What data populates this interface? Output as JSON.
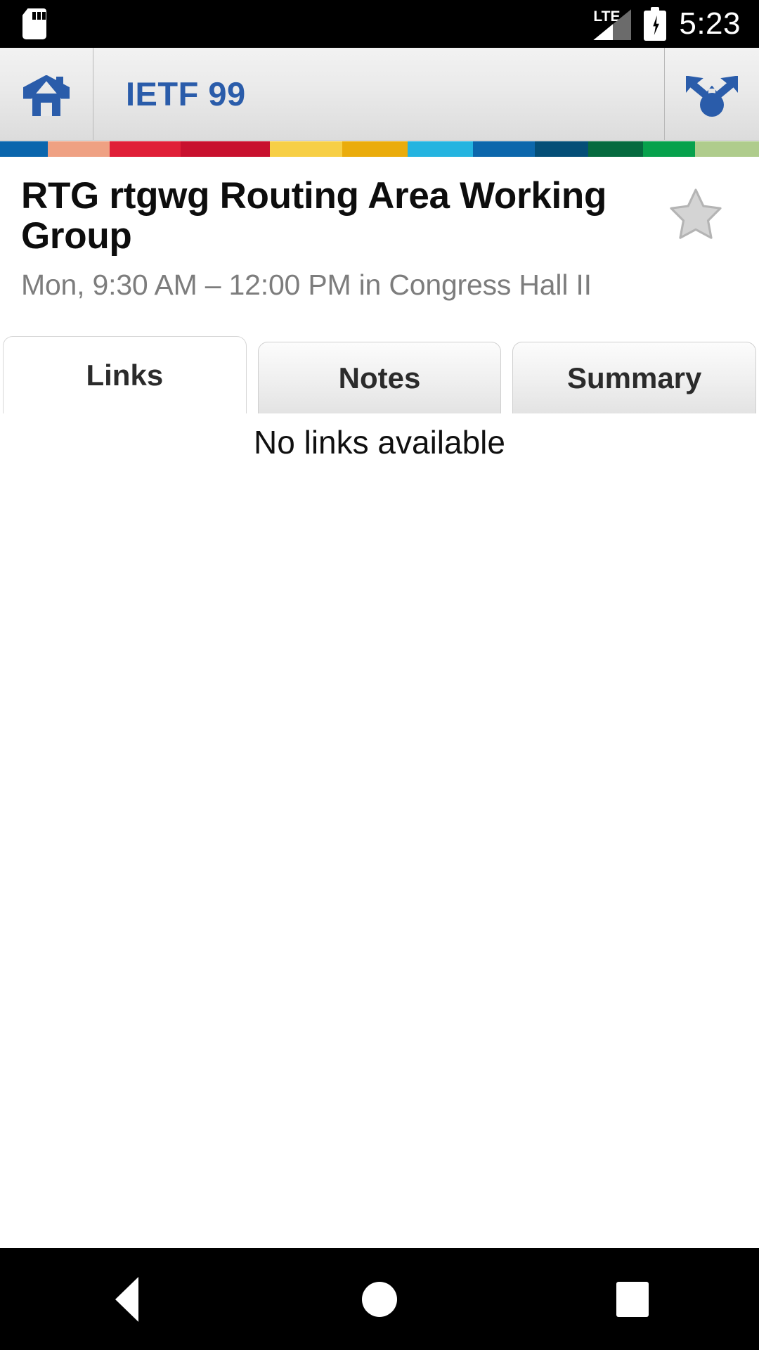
{
  "status_bar": {
    "sdcard_icon": "sd-card-icon",
    "network_label": "LTE",
    "signal_icon": "signal-bars-icon",
    "battery_icon": "battery-charging-icon",
    "time": "5:23"
  },
  "app_bar": {
    "home_icon": "home-icon",
    "title": "IETF 99",
    "share_icon": "share-icon"
  },
  "color_strip": [
    {
      "name": "segment-blue",
      "color": "#0B66AD",
      "width": 7.2
    },
    {
      "name": "segment-salmon",
      "color": "#EFA183",
      "width": 9.3
    },
    {
      "name": "segment-red",
      "color": "#E01F38",
      "width": 10.6
    },
    {
      "name": "segment-crimson",
      "color": "#C8102E",
      "width": 13.4
    },
    {
      "name": "segment-yellow",
      "color": "#F7CF46",
      "width": 10.9
    },
    {
      "name": "segment-amber",
      "color": "#EAAC0C",
      "width": 9.8
    },
    {
      "name": "segment-cyan",
      "color": "#24B4E0",
      "width": 9.8
    },
    {
      "name": "segment-blue-2",
      "color": "#0C67AC",
      "width": 9.3
    },
    {
      "name": "segment-dark-teal",
      "color": "#044E77",
      "width": 8.0
    },
    {
      "name": "segment-dark-green",
      "color": "#066A3F",
      "width": 8.3
    },
    {
      "name": "segment-green",
      "color": "#07A14C",
      "width": 7.8
    },
    {
      "name": "segment-sage",
      "color": "#AFCC8C",
      "width": 9.6
    }
  ],
  "event": {
    "title": "RTG rtgwg Routing Area Working Group",
    "schedule": "Mon, 9:30 AM – 12:00 PM in Congress Hall II",
    "favorite_icon": "star-outline-icon",
    "favorite_active": false
  },
  "tabs": [
    {
      "label": "Links",
      "active": true
    },
    {
      "label": "Notes",
      "active": false
    },
    {
      "label": "Summary",
      "active": false
    }
  ],
  "content": {
    "empty_message": "No links available"
  },
  "nav_bar": {
    "back": "back-triangle-icon",
    "home": "home-circle-icon",
    "recents": "recents-square-icon"
  },
  "colors": {
    "accent_blue": "#2A5CAA",
    "status_bar_bg": "#000000",
    "app_bar_bg": "#E8E8E8",
    "subtitle_gray": "#7D7D7D"
  }
}
